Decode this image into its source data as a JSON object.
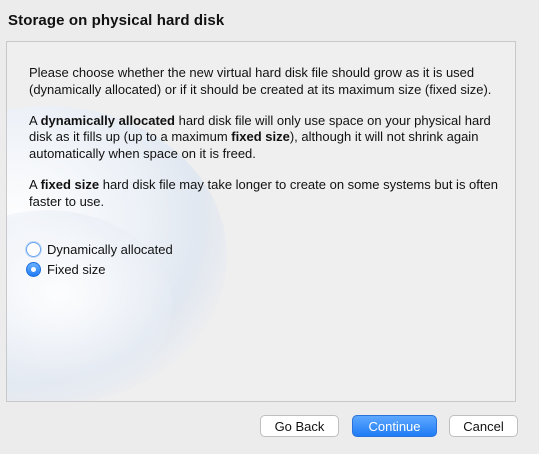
{
  "window": {
    "title": "Storage on physical hard disk"
  },
  "intro": {
    "text": "Please choose whether the new virtual hard disk file should grow as it is used (dynamically allocated) or if it should be created at its maximum size (fixed size)."
  },
  "dynamic_info": {
    "prefix": "A ",
    "bold1": "dynamically allocated",
    "middle": " hard disk file will only use space on your physical hard disk as it fills up (up to a maximum ",
    "bold2": "fixed size",
    "suffix": "), although it will not shrink again automatically when space on it is freed."
  },
  "fixed_info": {
    "prefix": "A ",
    "bold": "fixed size",
    "suffix": " hard disk file may take longer to create on some systems but is often faster to use."
  },
  "options": {
    "dynamic_label": "Dynamically allocated",
    "fixed_label": "Fixed size",
    "selected": "Fixed size"
  },
  "buttons": {
    "back": "Go Back",
    "continue": "Continue",
    "cancel": "Cancel"
  },
  "colors": {
    "accent": "#1f7cf5",
    "window_bg": "#ececec"
  }
}
